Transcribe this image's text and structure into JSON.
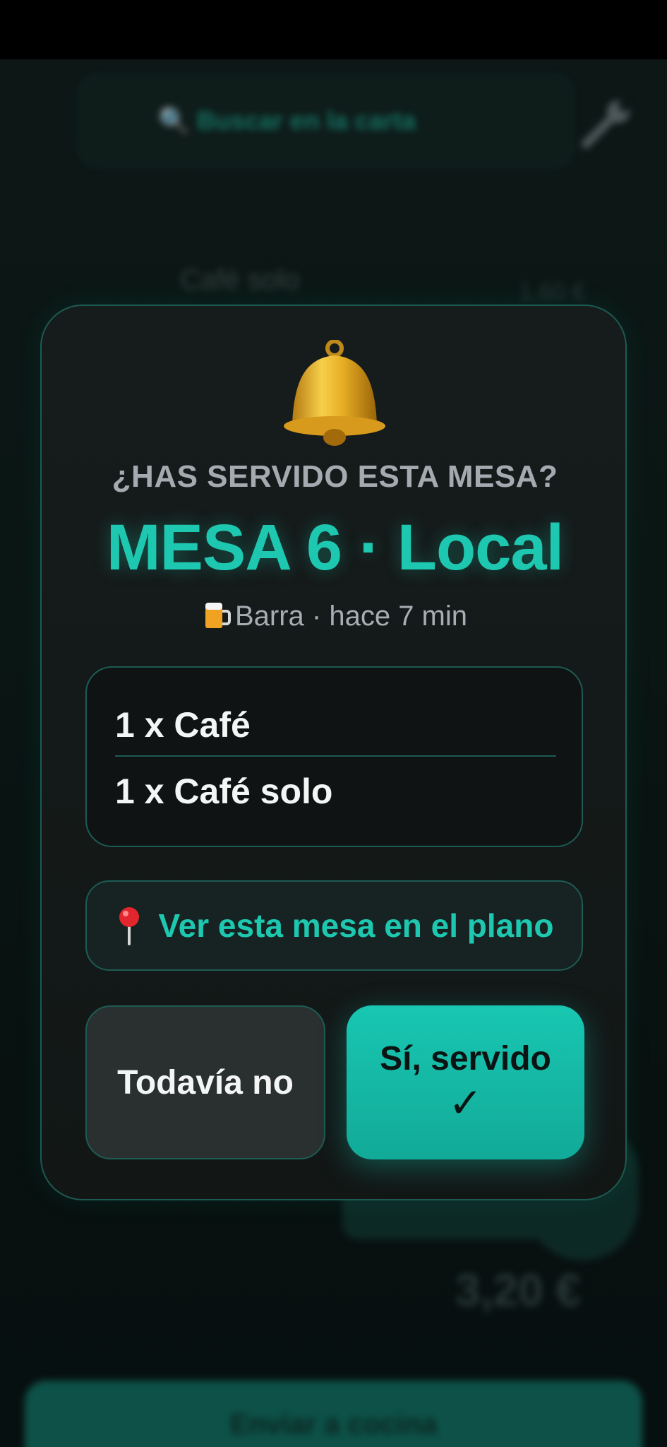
{
  "background": {
    "search_text": "🔍 Buscar en la carta",
    "item_name": "Café solo",
    "item_price": "1,60 €",
    "total": "3,20 €",
    "bottom_button": "Enviar a cocina"
  },
  "modal": {
    "question": "¿HAS SERVIDO ESTA MESA?",
    "table_title": "MESA 6 · Local",
    "meta": "Barra · hace 7 min",
    "order_items": [
      "1 x Café",
      "1 x Café solo"
    ],
    "map_button": "Ver esta mesa en el plano",
    "not_yet_button": "Todavía no",
    "served_button": "Sí, servido",
    "served_check": "✓"
  },
  "colors": {
    "accent": "#1ec8b0",
    "modal_bg": "#161c1c",
    "border": "#1d5b53"
  }
}
